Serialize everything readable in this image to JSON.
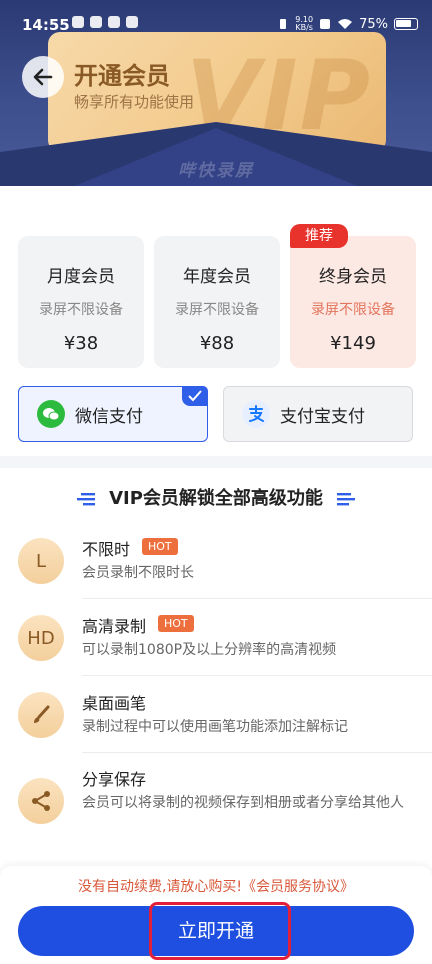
{
  "status_bar": {
    "time": "14:55",
    "net_speed_top": "9.10",
    "net_speed_bottom": "KB/s",
    "battery": "75%"
  },
  "header": {
    "title": "开通会员",
    "subtitle": "畅享所有功能使用",
    "watermark": "VIP",
    "brand": "哔快录屏"
  },
  "plans": [
    {
      "name": "月度会员",
      "desc": "录屏不限设备",
      "price": "¥38"
    },
    {
      "name": "年度会员",
      "desc": "录屏不限设备",
      "price": "¥88"
    },
    {
      "name": "终身会员",
      "desc": "录屏不限设备",
      "price": "¥149",
      "badge": "推荐"
    }
  ],
  "payment": {
    "wechat_label": "微信支付",
    "alipay_label": "支付宝支付",
    "selected": "wechat"
  },
  "features": {
    "heading": "VIP会员解锁全部高级功能",
    "items": [
      {
        "icon": "L",
        "name": "不限时",
        "badge": "HOT",
        "desc": "会员录制不限时长"
      },
      {
        "icon": "HD",
        "name": "高清录制",
        "badge": "HOT",
        "desc": "可以录制1080P及以上分辨率的高清视频"
      },
      {
        "icon": "brush-icon",
        "name": "桌面画笔",
        "desc": "录制过程中可以使用画笔功能添加注解标记"
      },
      {
        "icon": "share-icon",
        "name": "分享保存",
        "desc": "会员可以将录制的视频保存到相册或者分享给其他人"
      }
    ]
  },
  "footer": {
    "notice": "没有自动续费,请放心购买!《会员服务协议》",
    "cta_label": "立即开通"
  },
  "colors": {
    "primary": "#1f4fe0",
    "hot": "#ee6f3e",
    "recommend": "#e8332d",
    "gold_text": "#8a5a25"
  }
}
